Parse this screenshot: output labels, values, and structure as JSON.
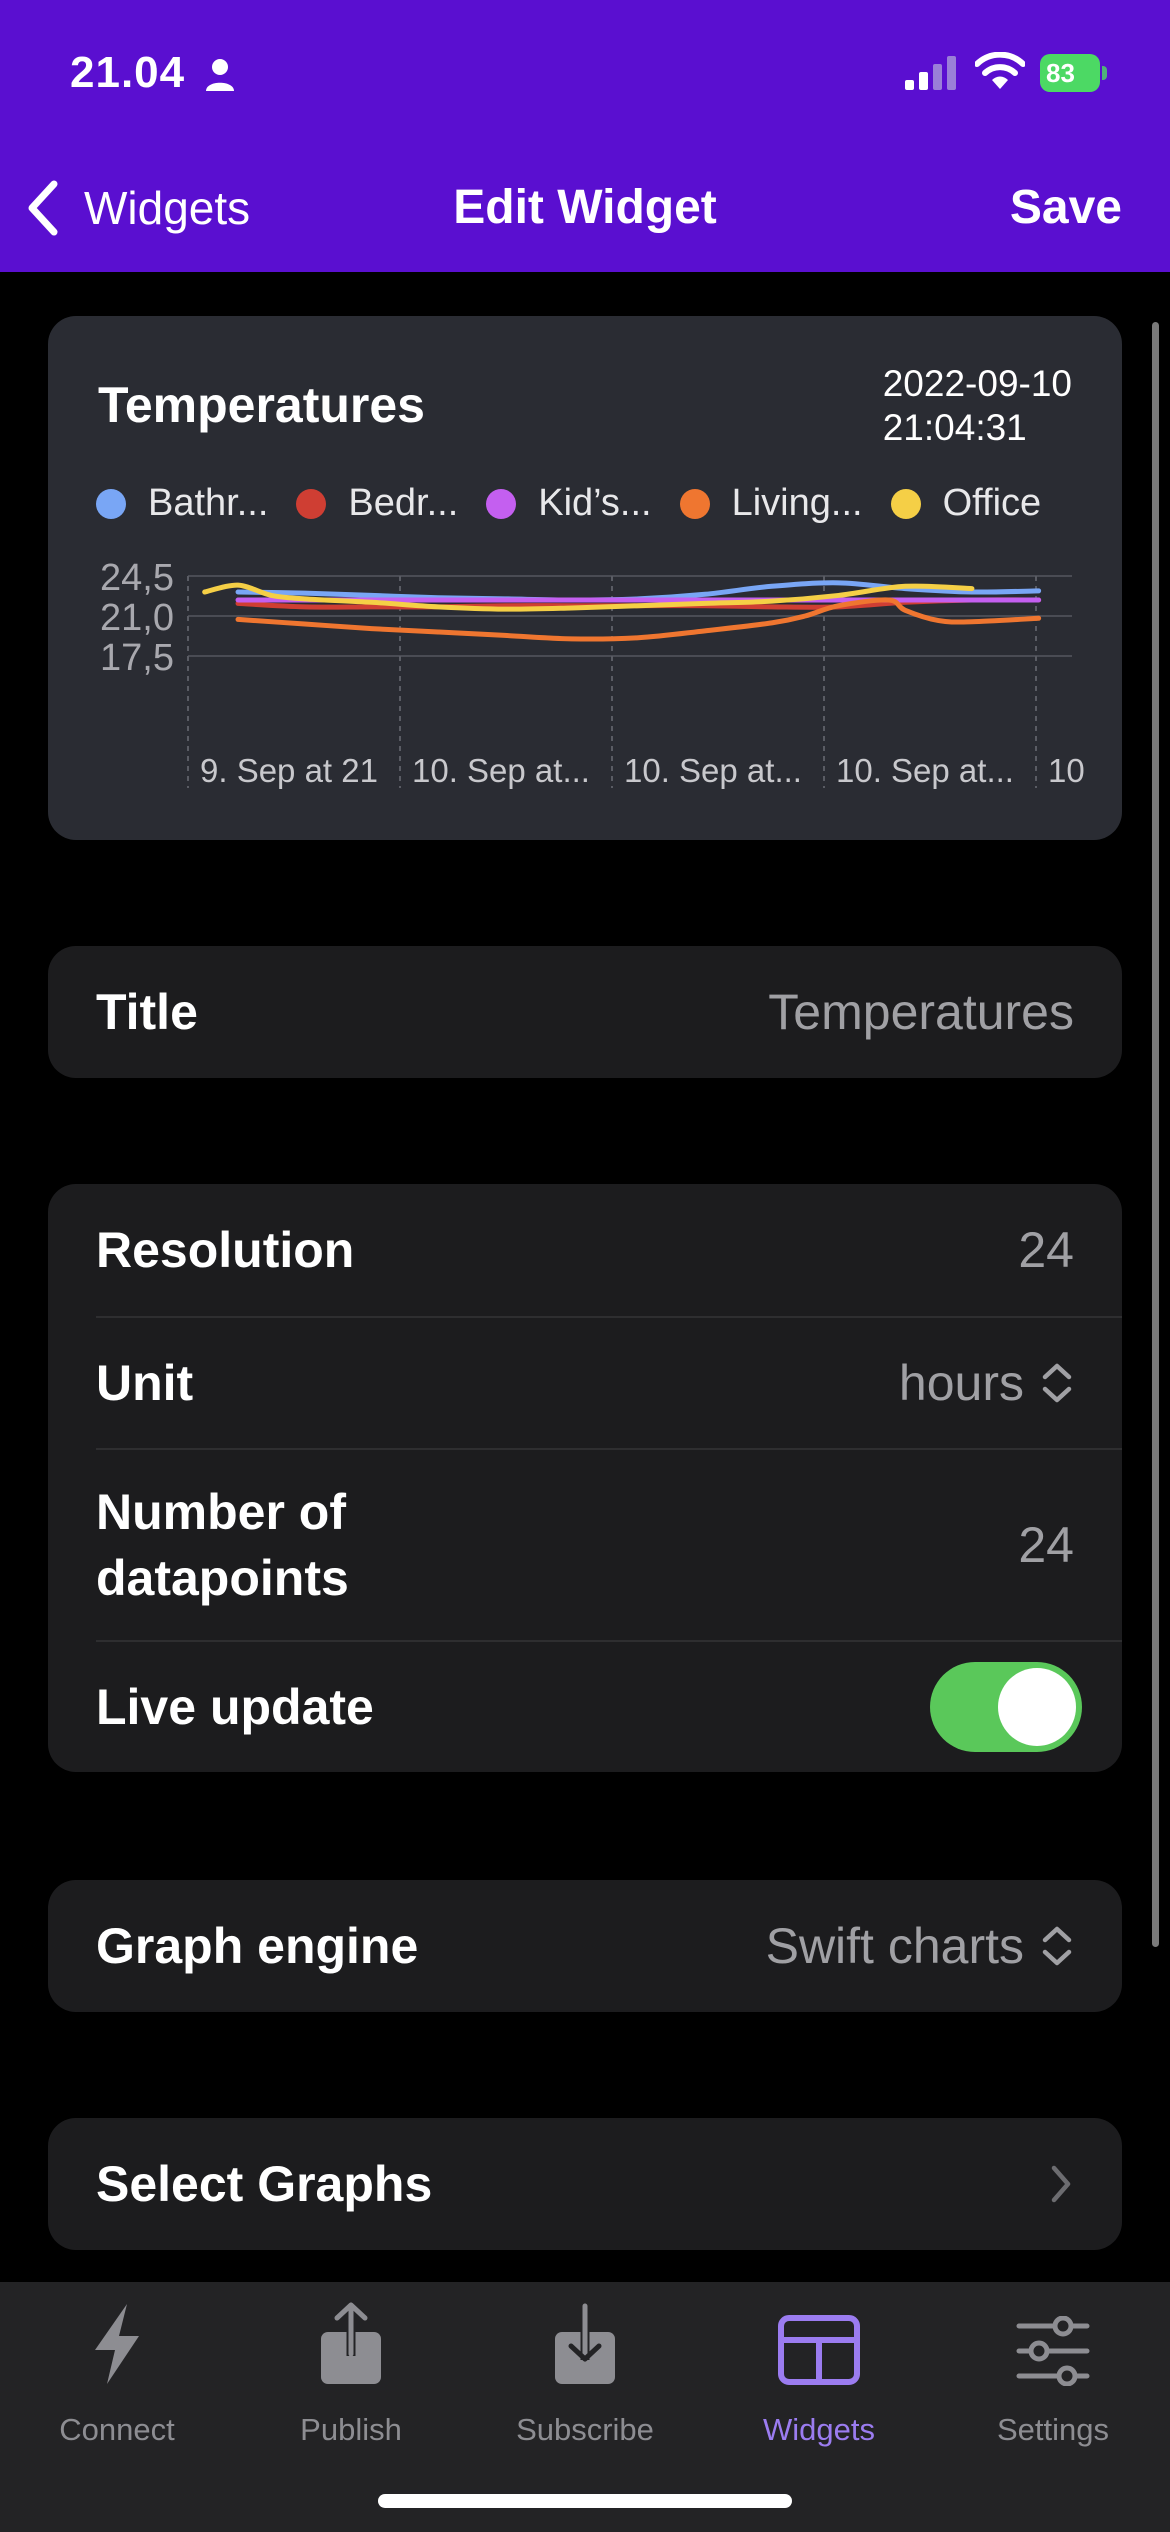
{
  "status_bar": {
    "time": "21.04",
    "battery": "83"
  },
  "nav": {
    "back_label": "Widgets",
    "title": "Edit Widget",
    "save_label": "Save"
  },
  "widget_preview": {
    "title": "Temperatures",
    "timestamp_line1": "2022-09-10",
    "timestamp_line2": "21:04:31",
    "legend": [
      {
        "label": "Bathr...",
        "color": "#79a6f5"
      },
      {
        "label": "Bedr...",
        "color": "#cf3e33"
      },
      {
        "label": "Kid’s...",
        "color": "#c45ff0"
      },
      {
        "label": "Living...",
        "color": "#ef7630"
      },
      {
        "label": "Office",
        "color": "#f5cf46"
      }
    ]
  },
  "chart_data": {
    "type": "line",
    "title": "Temperatures",
    "y_ticks": [
      "24,5",
      "21,0",
      "17,5"
    ],
    "ylim": [
      17.5,
      24.5
    ],
    "x_ticks": [
      "9. Sep at 21",
      "10. Sep at...",
      "10. Sep at...",
      "10. Sep at...",
      "10"
    ],
    "grid": true,
    "legend_position": "top",
    "series": [
      {
        "name": "Bathr...",
        "color": "#79a6f5",
        "x": [
          0.0,
          2.0,
          4.0,
          6.0,
          8.0,
          10.0,
          12.0,
          14.0,
          16.0,
          18.0,
          20.0,
          22.0,
          24.0
        ],
        "values": [
          23.1,
          23.0,
          22.8,
          22.6,
          22.5,
          22.4,
          22.5,
          22.9,
          23.6,
          23.9,
          23.4,
          23.1,
          23.2
        ]
      },
      {
        "name": "Bedr...",
        "color": "#cf3e33",
        "x": [
          0.0,
          2.0,
          4.0,
          6.0,
          8.0,
          10.0,
          12.0,
          14.0,
          16.0,
          18.0,
          20.0,
          22.0,
          24.0
        ],
        "values": [
          22.1,
          21.8,
          21.8,
          21.8,
          21.9,
          21.9,
          21.9,
          21.9,
          21.8,
          21.8,
          22.2,
          22.4,
          22.4
        ]
      },
      {
        "name": "Kid’s...",
        "color": "#c45ff0",
        "x": [
          0.0,
          4.0,
          8.0,
          12.0,
          16.0,
          20.0,
          24.0
        ],
        "values": [
          22.4,
          22.4,
          22.4,
          22.4,
          22.4,
          22.4,
          22.4
        ]
      },
      {
        "name": "Living...",
        "color": "#ef7630",
        "x": [
          0.0,
          2.0,
          4.0,
          6.0,
          8.0,
          10.0,
          12.0,
          14.0,
          16.0,
          17.0,
          18.0,
          19.5,
          20.0,
          21.0,
          22.0,
          24.0
        ],
        "values": [
          20.7,
          20.3,
          19.9,
          19.6,
          19.3,
          19.0,
          19.1,
          19.7,
          20.4,
          21.0,
          21.9,
          22.4,
          21.5,
          20.6,
          20.5,
          20.8
        ]
      },
      {
        "name": "Office",
        "color": "#f5cf46",
        "x": [
          -1.0,
          0.0,
          1.0,
          2.0,
          4.0,
          6.0,
          8.0,
          10.0,
          12.0,
          14.0,
          16.0,
          18.0,
          20.0,
          22.0
        ],
        "values": [
          23.1,
          23.7,
          22.8,
          22.5,
          22.2,
          21.8,
          21.6,
          21.7,
          21.9,
          22.1,
          22.3,
          22.8,
          23.6,
          23.4
        ]
      }
    ]
  },
  "title_row": {
    "label": "Title",
    "value": "Temperatures"
  },
  "settings": {
    "resolution_label": "Resolution",
    "resolution_value": "24",
    "unit_label": "Unit",
    "unit_value": "hours",
    "datapoints_label_line1": "Number of",
    "datapoints_label_line2": "datapoints",
    "datapoints_value": "24",
    "live_update_label": "Live update",
    "live_update_on": true
  },
  "engine_row": {
    "label": "Graph engine",
    "value": "Swift charts"
  },
  "select_graphs_row": {
    "label": "Select Graphs"
  },
  "tabs": [
    {
      "label": "Connect",
      "icon": "bolt-icon"
    },
    {
      "label": "Publish",
      "icon": "upload-icon"
    },
    {
      "label": "Subscribe",
      "icon": "download-icon"
    },
    {
      "label": "Widgets",
      "icon": "widgets-icon",
      "active": true
    },
    {
      "label": "Settings",
      "icon": "sliders-icon"
    }
  ]
}
